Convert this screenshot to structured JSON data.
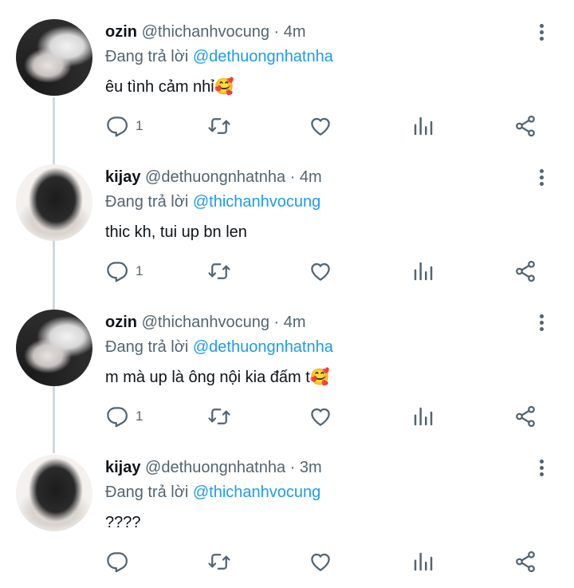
{
  "replying_prefix": "Đang trả lời",
  "tweets": [
    {
      "name": "ozin",
      "handle": "@thichanhvocung",
      "separator": "·",
      "time": "4m",
      "replying_to": "@dethuongnhatnha",
      "text": "êu tình cảm nhỉ",
      "emoji": "🥰",
      "reply_count": "1",
      "avatar": "ozin"
    },
    {
      "name": "kijay",
      "handle": "@dethuongnhatnha",
      "separator": "·",
      "time": "4m",
      "replying_to": "@thichanhvocung",
      "text": "thic kh, tui up bn len",
      "emoji": "",
      "reply_count": "1",
      "avatar": "kijay"
    },
    {
      "name": "ozin",
      "handle": "@thichanhvocung",
      "separator": "·",
      "time": "4m",
      "replying_to": "@dethuongnhatnha",
      "text": "m mà up là ông nội kia đấm t",
      "emoji": "🥰",
      "reply_count": "1",
      "avatar": "ozin"
    },
    {
      "name": "kijay",
      "handle": "@dethuongnhatnha",
      "separator": "·",
      "time": "3m",
      "replying_to": "@thichanhvocung",
      "text": "????",
      "emoji": "",
      "reply_count": "",
      "avatar": "kijay"
    }
  ],
  "icons": {
    "reply": "reply-icon",
    "retweet": "retweet-icon",
    "like": "heart-icon",
    "stats": "stats-icon",
    "share": "share-icon",
    "more": "more-vertical-icon"
  },
  "colors": {
    "link": "#1d9bf0",
    "muted": "#536471",
    "text": "#0f1419",
    "thread_line": "#cfd9de"
  }
}
